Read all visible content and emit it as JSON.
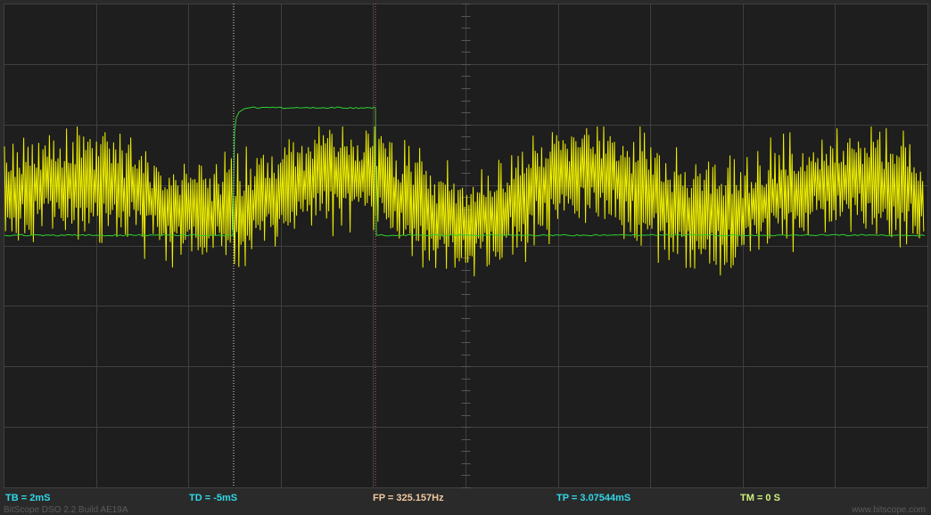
{
  "colors": {
    "background": "#2a2a2a",
    "screen": "#1e1e1e",
    "grid": "#3f3f3f",
    "channel_a": "#f0f000",
    "channel_b": "#2fd12f",
    "time_cursor": "#e8e8d0",
    "trigger_cursor": "#d06a60",
    "label_cyan": "#2fd8e8",
    "label_peach": "#f0c8a0",
    "label_lime": "#d0f080"
  },
  "status_bar": {
    "tb": {
      "label": "TB = 2mS",
      "color": "#2fd8e8"
    },
    "td": {
      "label": "TD = -5mS",
      "color": "#2fd8e8"
    },
    "fp": {
      "label": "FP = 325.157Hz",
      "color": "#f0c8a0"
    },
    "tp": {
      "label": "TP = 3.07544mS",
      "color": "#2fd8e8"
    },
    "tm": {
      "label": "TM = 0 S",
      "color": "#d0f080"
    }
  },
  "footer": {
    "build": "BitScope DSO 2.2 Build AE19A",
    "website": "www.bitscope.com"
  }
}
